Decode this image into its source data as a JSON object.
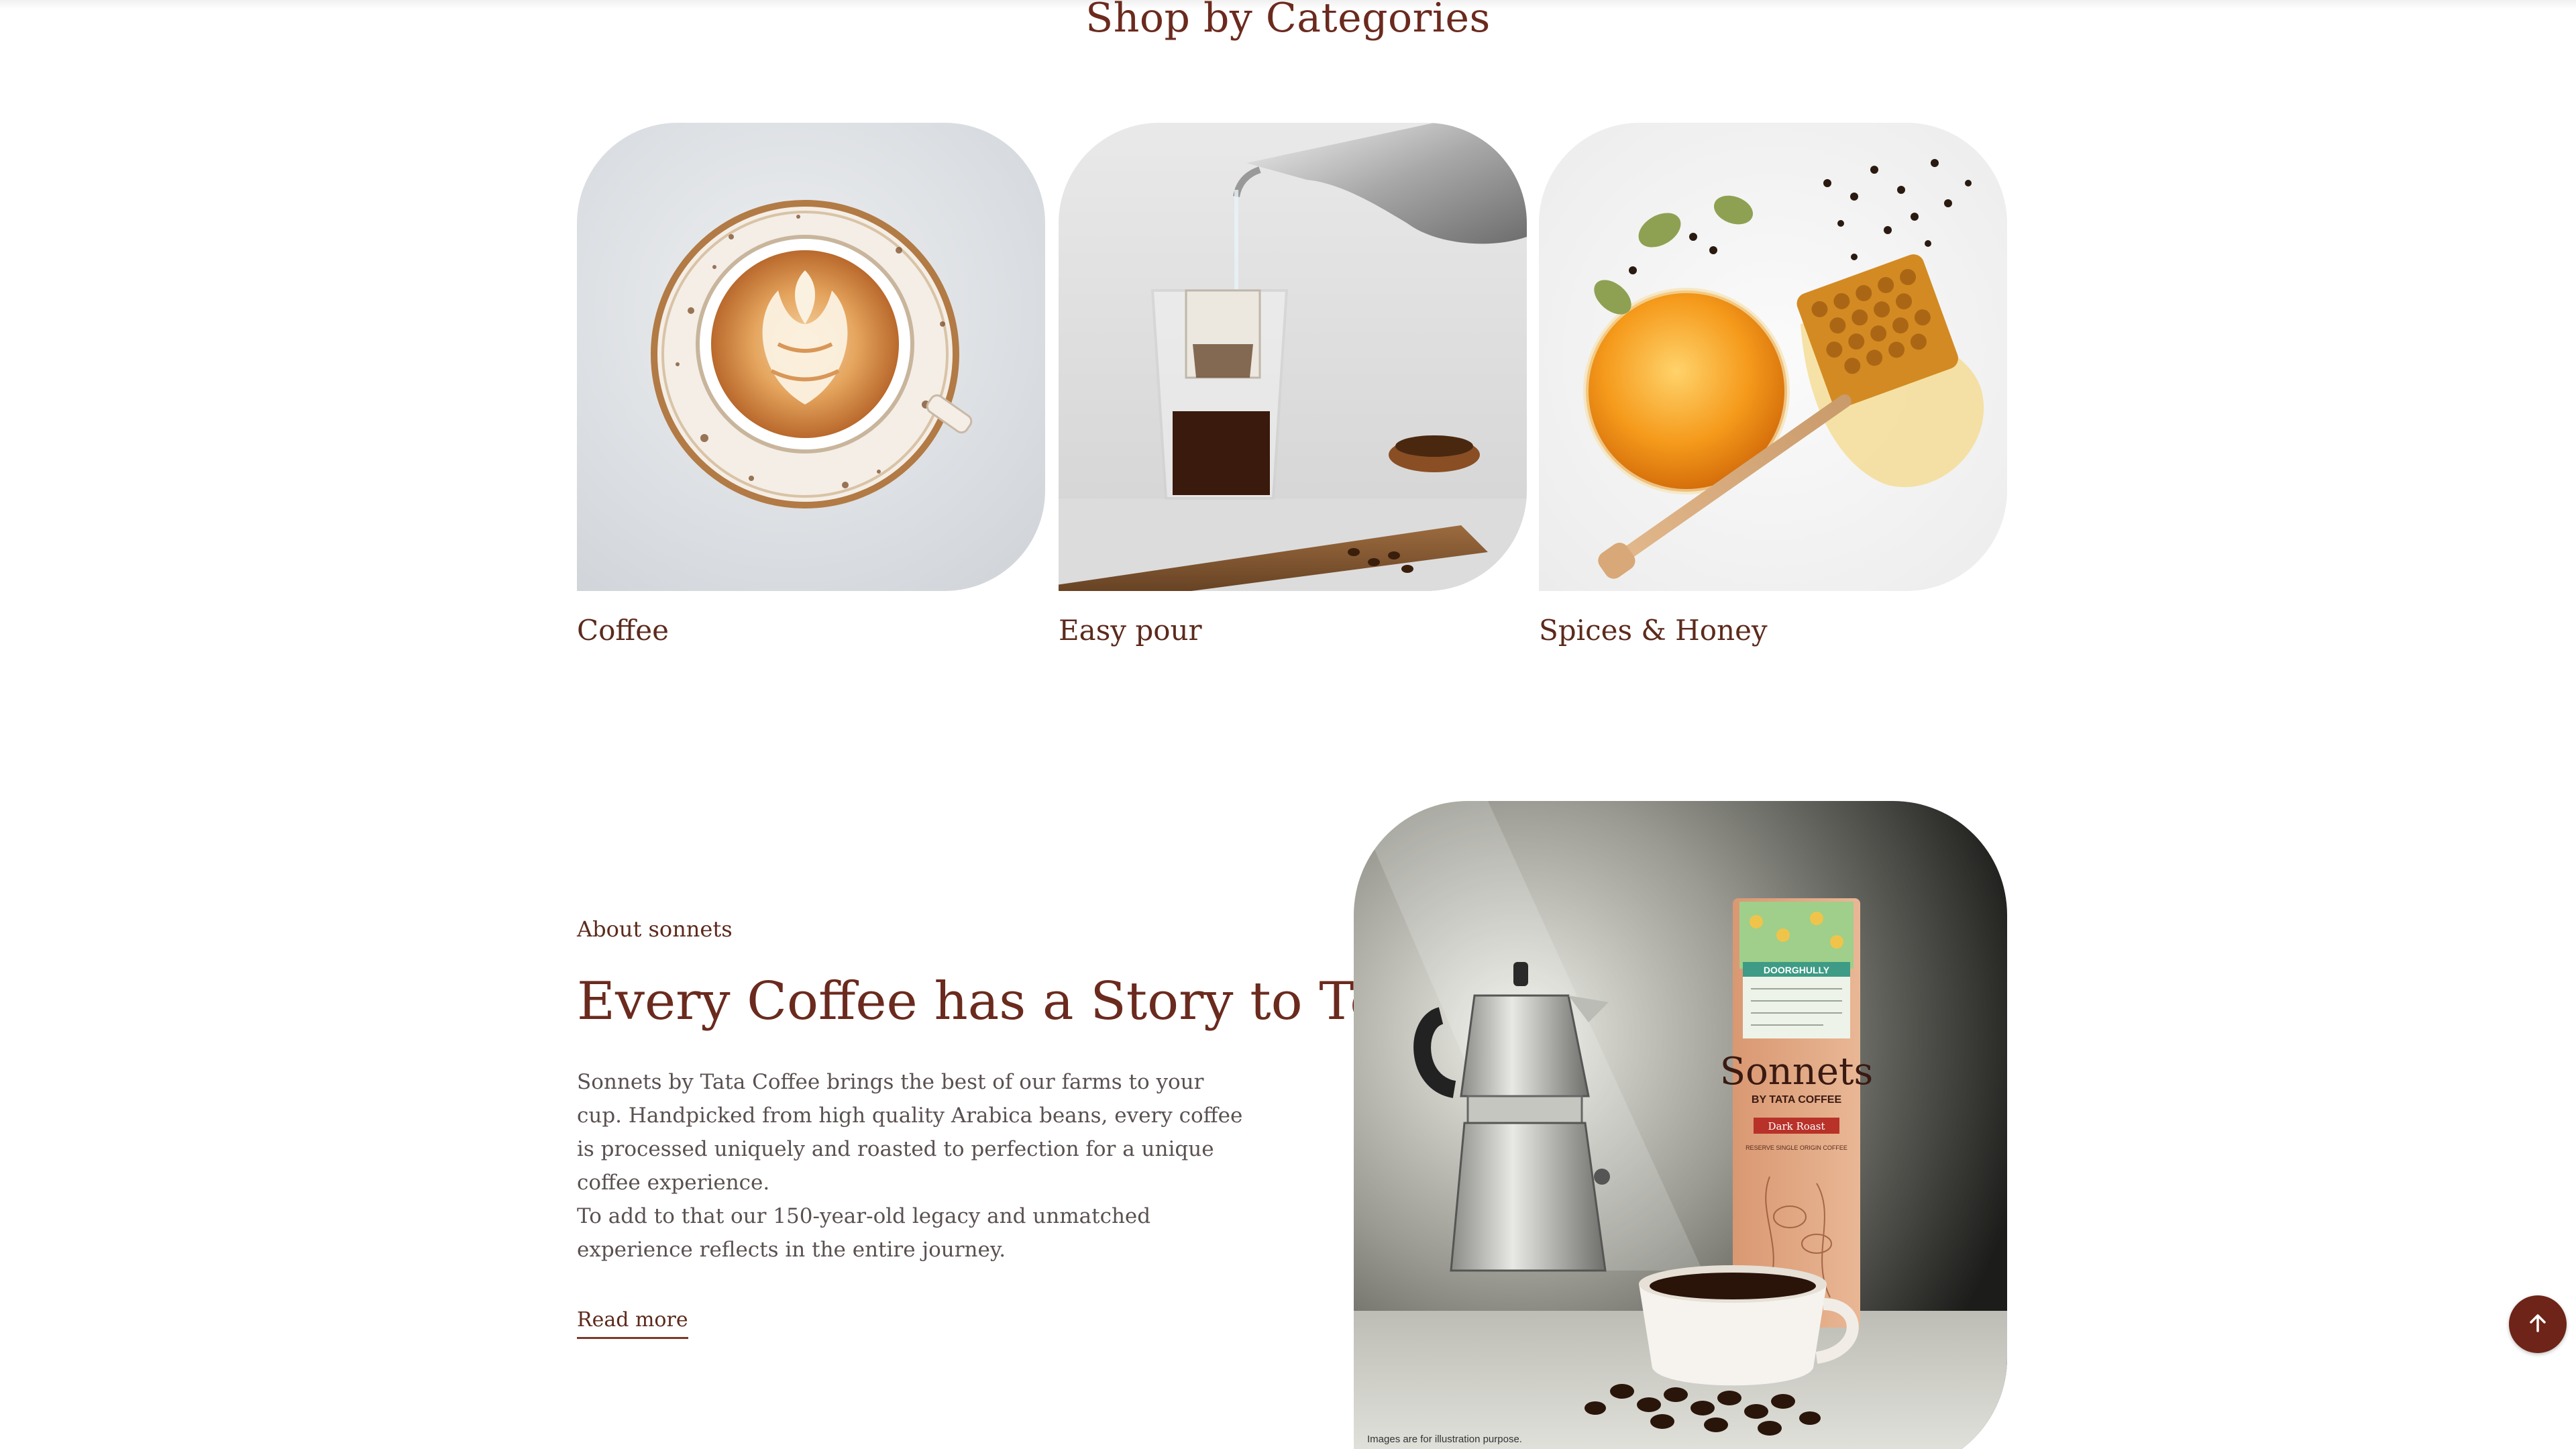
{
  "categories_section": {
    "title": "Shop by Categories",
    "items": [
      {
        "label": "Coffee",
        "image": "latte-art-cup-image"
      },
      {
        "label": "Easy pour",
        "image": "drip-bag-pour-image"
      },
      {
        "label": "Spices & Honey",
        "image": "honey-spices-image"
      }
    ]
  },
  "about": {
    "eyebrow": "About sonnets",
    "heading": "Every Coffee has a Story to Tell",
    "paragraph_1": "Sonnets by Tata Coffee brings the best of our farms to your cup. Handpicked from high quality Arabica beans, every coffee is processed uniquely and roasted to perfection for a unique coffee experience.",
    "paragraph_2": "To add to that our 150-year-old legacy and unmatched experience reflects in the entire journey.",
    "read_more": "Read more",
    "image_disclaimer": "Images are for illustration purpose.",
    "package": {
      "brand": "Sonnets",
      "by_line": "BY TATA COFFEE",
      "estate": "DOORGHULLY",
      "roast": "Dark Roast",
      "subline": "RESERVE SINGLE ORIGIN COFFEE"
    }
  },
  "back_to_top": {
    "icon": "arrow-up-icon"
  },
  "colors": {
    "brand_brown": "#6b2a1e",
    "button_bg": "#6e2418",
    "body_text": "#5a5050"
  }
}
